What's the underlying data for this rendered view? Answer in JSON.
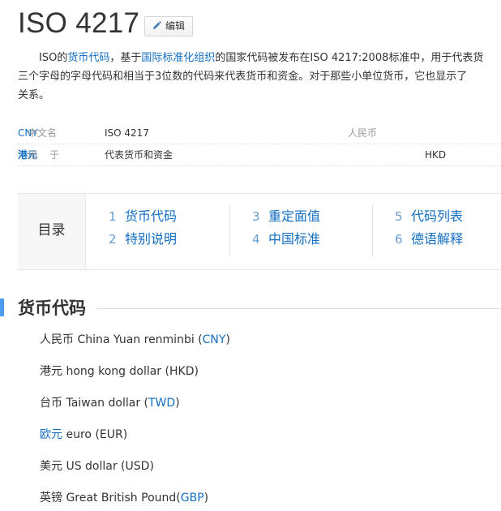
{
  "page": {
    "title": "ISO 4217",
    "edit_label": "编辑"
  },
  "intro": {
    "line1": [
      {
        "t": "ISO的"
      },
      {
        "t": "货币代码",
        "link": true
      },
      {
        "t": "，基于"
      },
      {
        "t": "国际标准化组织",
        "link": true
      },
      {
        "t": "的国家代码被发布在ISO 4217:2008标准中，用于代表货"
      }
    ],
    "line2": "三个字母的字母代码和相当于3位数的代码来代表货币和资金。对于那些小单位货币，它也显示了",
    "line3": "关系。"
  },
  "basic_info": {
    "rows": [
      {
        "k1": "中文名",
        "v1": "ISO 4217",
        "k2": "人民币",
        "v2": "CNY"
      },
      {
        "k1": "用    于",
        "v1": "代表货币和资金",
        "k2": "港元",
        "v2": "HKD"
      }
    ]
  },
  "toc": {
    "heading": "目录",
    "items": [
      {
        "num": "1",
        "label": "货币代码"
      },
      {
        "num": "2",
        "label": "特别说明"
      },
      {
        "num": "3",
        "label": "重定面值"
      },
      {
        "num": "4",
        "label": "中国标准"
      },
      {
        "num": "5",
        "label": "代码列表"
      },
      {
        "num": "6",
        "label": "德语解释"
      }
    ]
  },
  "section": {
    "title": "货币代码"
  },
  "currencies": [
    {
      "cn": "人民币",
      "en": "China Yuan renminbi",
      "code": "CNY"
    },
    {
      "cn": "港元",
      "en": "hong kong dollar",
      "code": "HKD"
    },
    {
      "cn": "台币",
      "en": "Taiwan dollar",
      "code": "TWD"
    },
    {
      "cn": "欧元",
      "en": "euro",
      "code": "EUR"
    },
    {
      "cn": "美元",
      "en": "US dollar",
      "code": "USD"
    },
    {
      "cn": "英镑",
      "en": "Great British Pound",
      "code": "GBP"
    }
  ],
  "colors": {
    "link": "#136ec2",
    "section_bar": "#4f9cee"
  }
}
